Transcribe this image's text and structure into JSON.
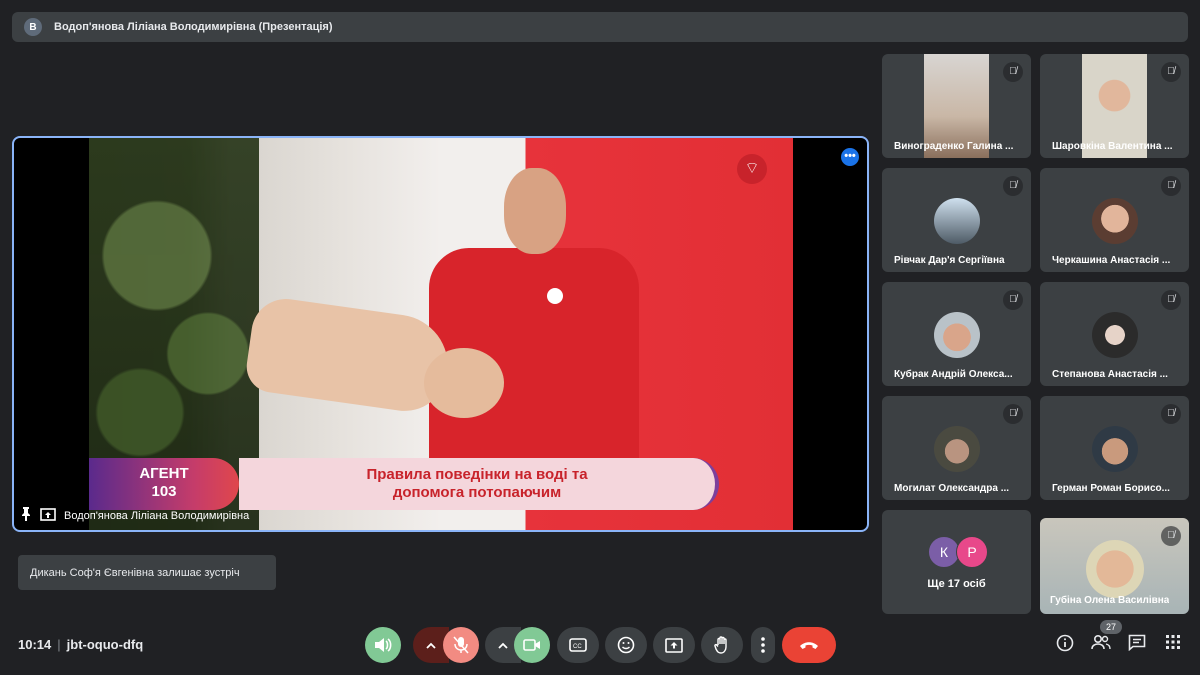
{
  "presentation": {
    "avatar_letter": "В",
    "title": "Водоп'янова Ліліана Володимирівна (Презентація)"
  },
  "stage": {
    "presenter_name": "Водоп'янова Ліліана Володимирівна",
    "video_overlay": {
      "agent_line1": "АГЕНТ",
      "agent_line2": "103",
      "title_line1": "Правила поведінки на воді та",
      "title_line2": "допомога потопаючим"
    }
  },
  "toast": "Дикань Соф'я Євгенівна залишає зустріч",
  "participants": [
    {
      "name": "Винограденко Галина ...",
      "muted": true
    },
    {
      "name": "Шаровкіна Валентина ...",
      "muted": true
    },
    {
      "name": "Рівчак Дар'я Сергіївна",
      "muted": true
    },
    {
      "name": "Черкашина Анастасія ...",
      "muted": true
    },
    {
      "name": "Кубрак Андрій Олекса...",
      "muted": true
    },
    {
      "name": "Степанова Анастасія ...",
      "muted": true
    },
    {
      "name": "Могилат Олександра ...",
      "muted": true
    },
    {
      "name": "Герман Роман Борисо...",
      "muted": true
    },
    {
      "name": "Губіна Олена Василівна",
      "muted": true
    }
  ],
  "more_tile": {
    "avatars": [
      {
        "letter": "К",
        "color": "#7b5ea7"
      },
      {
        "letter": "Р",
        "color": "#e8488a"
      }
    ],
    "label": "Ще 17 осіб"
  },
  "meeting": {
    "time": "10:14",
    "separator": "|",
    "code": "jbt-oquo-dfq"
  },
  "controls": {
    "participant_count": "27"
  },
  "colors": {
    "background": "#202124",
    "tile": "#3c4043",
    "accent_blue": "#8ab4f8",
    "mic_off_red": "#f28b82",
    "speaker_green": "#81c995",
    "hangup_red": "#ea4335"
  }
}
